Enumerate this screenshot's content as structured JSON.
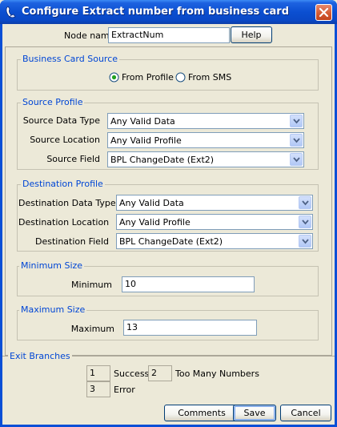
{
  "window": {
    "title": "Configure Extract number from business card",
    "close_icon": "close-icon",
    "title_icon": "phone-handset-icon"
  },
  "node": {
    "label": "Node name",
    "value": "ExtractNum",
    "help_label": "Help"
  },
  "business_card_source": {
    "title": "Business Card Source",
    "options": [
      {
        "label": "From Profile",
        "selected": true
      },
      {
        "label": "From SMS",
        "selected": false
      }
    ]
  },
  "source_profile": {
    "title": "Source Profile",
    "fields": [
      {
        "label": "Source Data Type",
        "value": "Any Valid Data"
      },
      {
        "label": "Source Location",
        "value": "Any Valid Profile"
      },
      {
        "label": "Source Field",
        "value": "BPL ChangeDate (Ext2)"
      }
    ]
  },
  "destination_profile": {
    "title": "Destination Profile",
    "fields": [
      {
        "label": "Destination Data Type",
        "value": "Any Valid Data"
      },
      {
        "label": "Destination Location",
        "value": "Any Valid Profile"
      },
      {
        "label": "Destination Field",
        "value": "BPL ChangeDate (Ext2)"
      }
    ]
  },
  "minimum_size": {
    "title": "Minimum Size",
    "label": "Minimum",
    "value": "10"
  },
  "maximum_size": {
    "title": "Maximum Size",
    "label": "Maximum",
    "value": "13"
  },
  "exit_branches": {
    "title": "Exit Branches",
    "items": [
      {
        "number": "1",
        "label": "Success"
      },
      {
        "number": "2",
        "label": "Too Many Numbers"
      },
      {
        "number": "3",
        "label": "Error"
      }
    ]
  },
  "buttons": {
    "comments": "Comments",
    "save": "Save",
    "cancel": "Cancel"
  },
  "colors": {
    "title_bar": "#0a4fd6",
    "group_title": "#0046d5",
    "dialog_bg": "#ece9d8",
    "close_button": "#d45b34"
  }
}
